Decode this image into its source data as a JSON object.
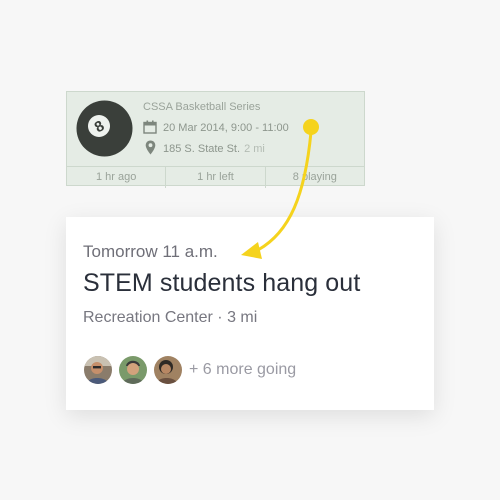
{
  "old_card": {
    "title": "CSSA Basketball Series",
    "datetime": "20 Mar 2014, 9:00 - 11:00",
    "address": "185 S. State St.",
    "distance": "2 mi",
    "stats": [
      "1 hr ago",
      "1 hr left",
      "8 playing"
    ],
    "icon": "8-ball-icon"
  },
  "new_card": {
    "when": "Tomorrow 11 a.m.",
    "title": "STEM students hang out",
    "where": "Recreation Center · 3 mi",
    "more_going": "+ 6 more going",
    "avatars": [
      "avatar-1",
      "avatar-2",
      "avatar-3"
    ]
  },
  "colors": {
    "arrow": "#f5d31d",
    "old_card_bg": "#e5ece5",
    "new_card_bg": "#ffffff"
  }
}
